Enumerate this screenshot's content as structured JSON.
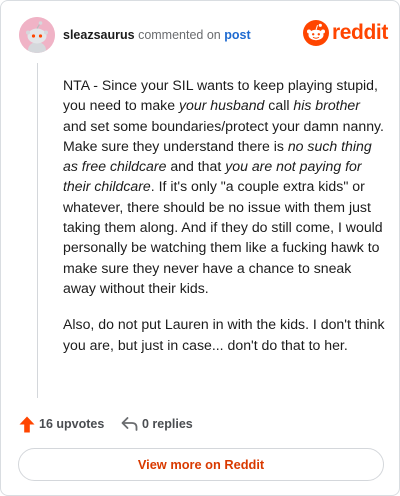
{
  "header": {
    "username": "sleazsaurus",
    "commented_text": "commented on",
    "post_link": "post",
    "brand": "reddit"
  },
  "comment": {
    "p1_a": "NTA - Since your SIL wants to keep playing stupid, you need to make ",
    "p1_em1": "your husband",
    "p1_b": " call ",
    "p1_em2": "his brother",
    "p1_c": " and set some boundaries/protect your damn nanny. Make sure they understand there is ",
    "p1_em3": "no such thing as free childcare",
    "p1_d": " and that ",
    "p1_em4": "you are not paying for their childcare",
    "p1_e": ". If it's only \"a couple extra kids\" or whatever, there should be no issue with them just taking them along. And if they do still come, I would personally be watching them like a fucking hawk to make sure they never have a chance to sneak away without their kids.",
    "p2": "Also, do not put Lauren in with the kids. I don't think you are, but just in case... don't do that to her."
  },
  "actions": {
    "upvotes": "16 upvotes",
    "replies": "0 replies"
  },
  "footer": {
    "view_more": "View more on Reddit"
  },
  "colors": {
    "brand": "#ff4500",
    "upvote_arrow": "#ff4500",
    "link": "#1e6ad0",
    "view_more": "#d93a00"
  },
  "icons": {
    "avatar": "snoo-avatar-icon",
    "brand": "reddit-logo-icon",
    "upvote": "upvote-arrow-icon",
    "reply": "reply-arrow-icon"
  }
}
